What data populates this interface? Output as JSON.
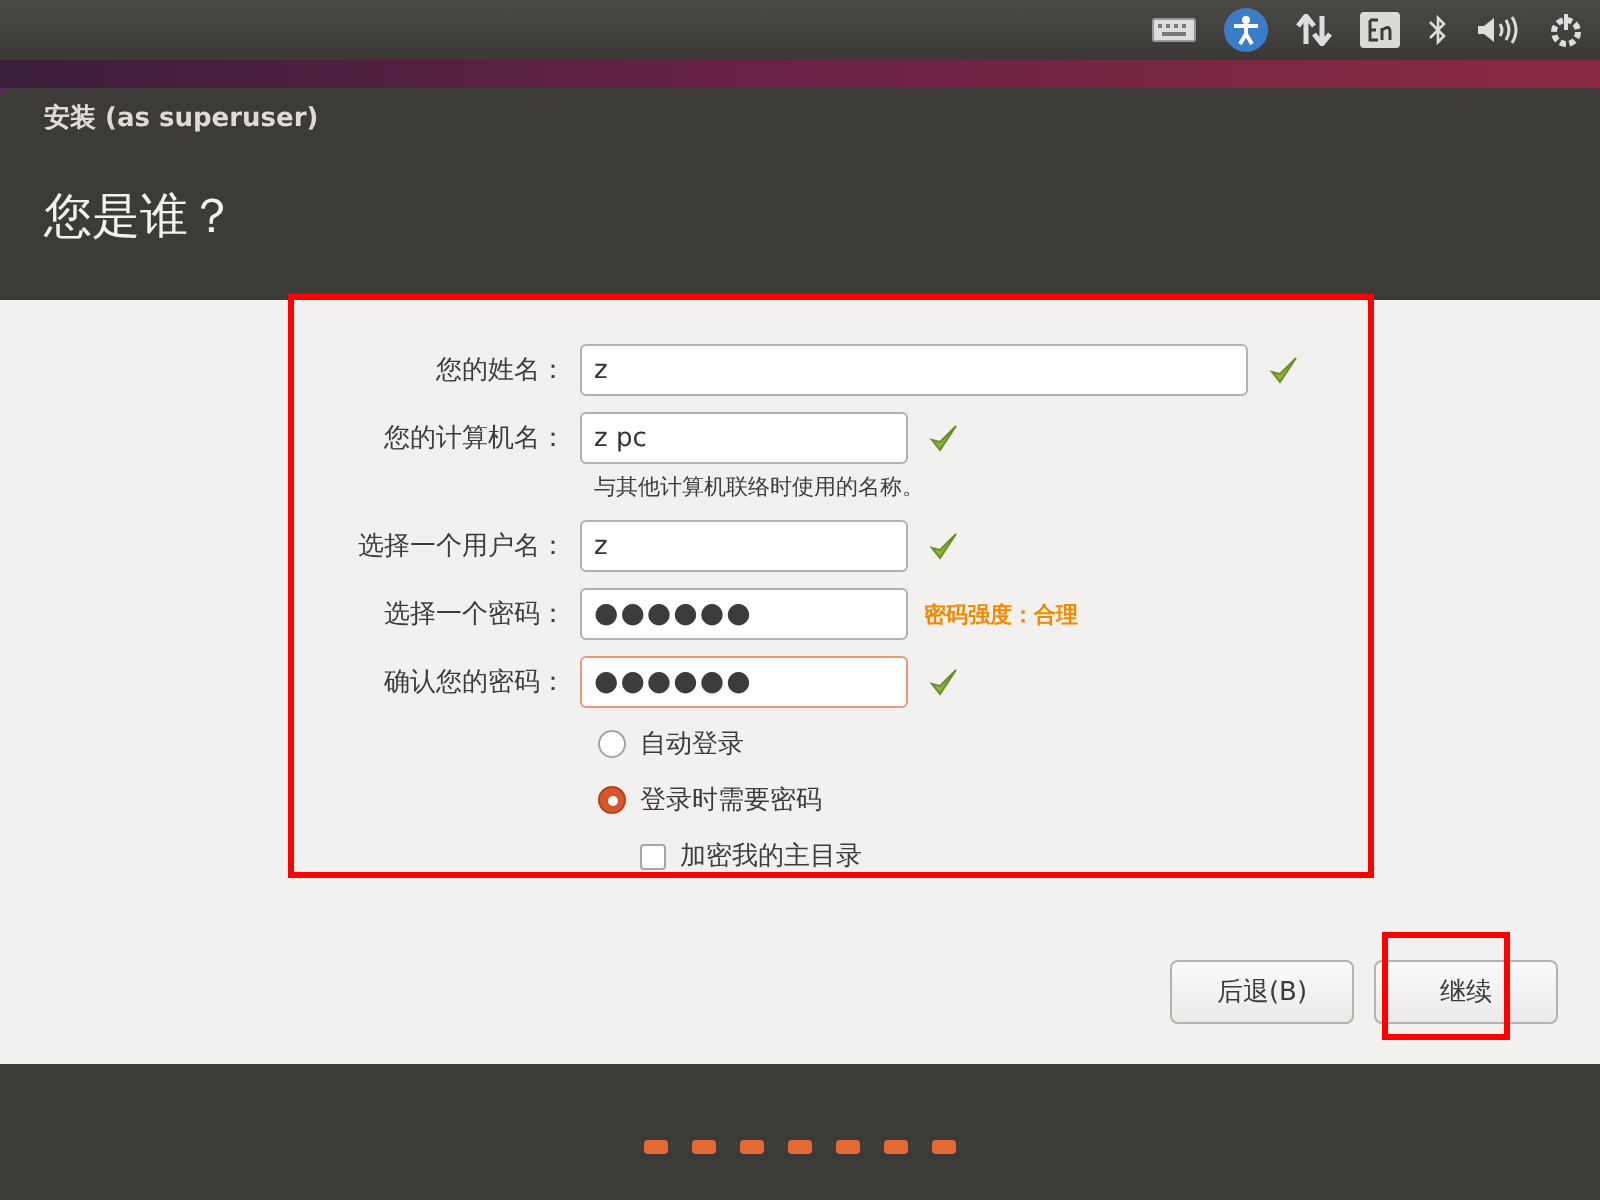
{
  "window": {
    "title": "安装 (as superuser)",
    "heading": "您是谁？"
  },
  "fields": [
    {
      "label": "您的姓名：",
      "value": "z",
      "kind": "text",
      "wide": true,
      "valid": true,
      "focused": false
    },
    {
      "label": "您的计算机名：",
      "value": "z pc",
      "kind": "text",
      "wide": false,
      "valid": true,
      "focused": false,
      "hint": "与其他计算机联络时使用的名称。"
    },
    {
      "label": "选择一个用户名：",
      "value": "z",
      "kind": "text",
      "wide": false,
      "valid": true,
      "focused": false
    },
    {
      "label": "选择一个密码：",
      "value": "●●●●●●",
      "kind": "password",
      "wide": false,
      "valid": false,
      "focused": false,
      "strength": "密码强度：合理"
    },
    {
      "label": "确认您的密码：",
      "value": "●●●●●●",
      "kind": "password",
      "wide": false,
      "valid": true,
      "focused": true
    }
  ],
  "login_options": [
    {
      "label": "自动登录",
      "selected": false
    },
    {
      "label": "登录时需要密码",
      "selected": true
    }
  ],
  "encrypt_home": {
    "label": "加密我的主目录",
    "checked": false
  },
  "buttons": [
    {
      "label": "后退(B)"
    },
    {
      "label": "继续"
    }
  ]
}
